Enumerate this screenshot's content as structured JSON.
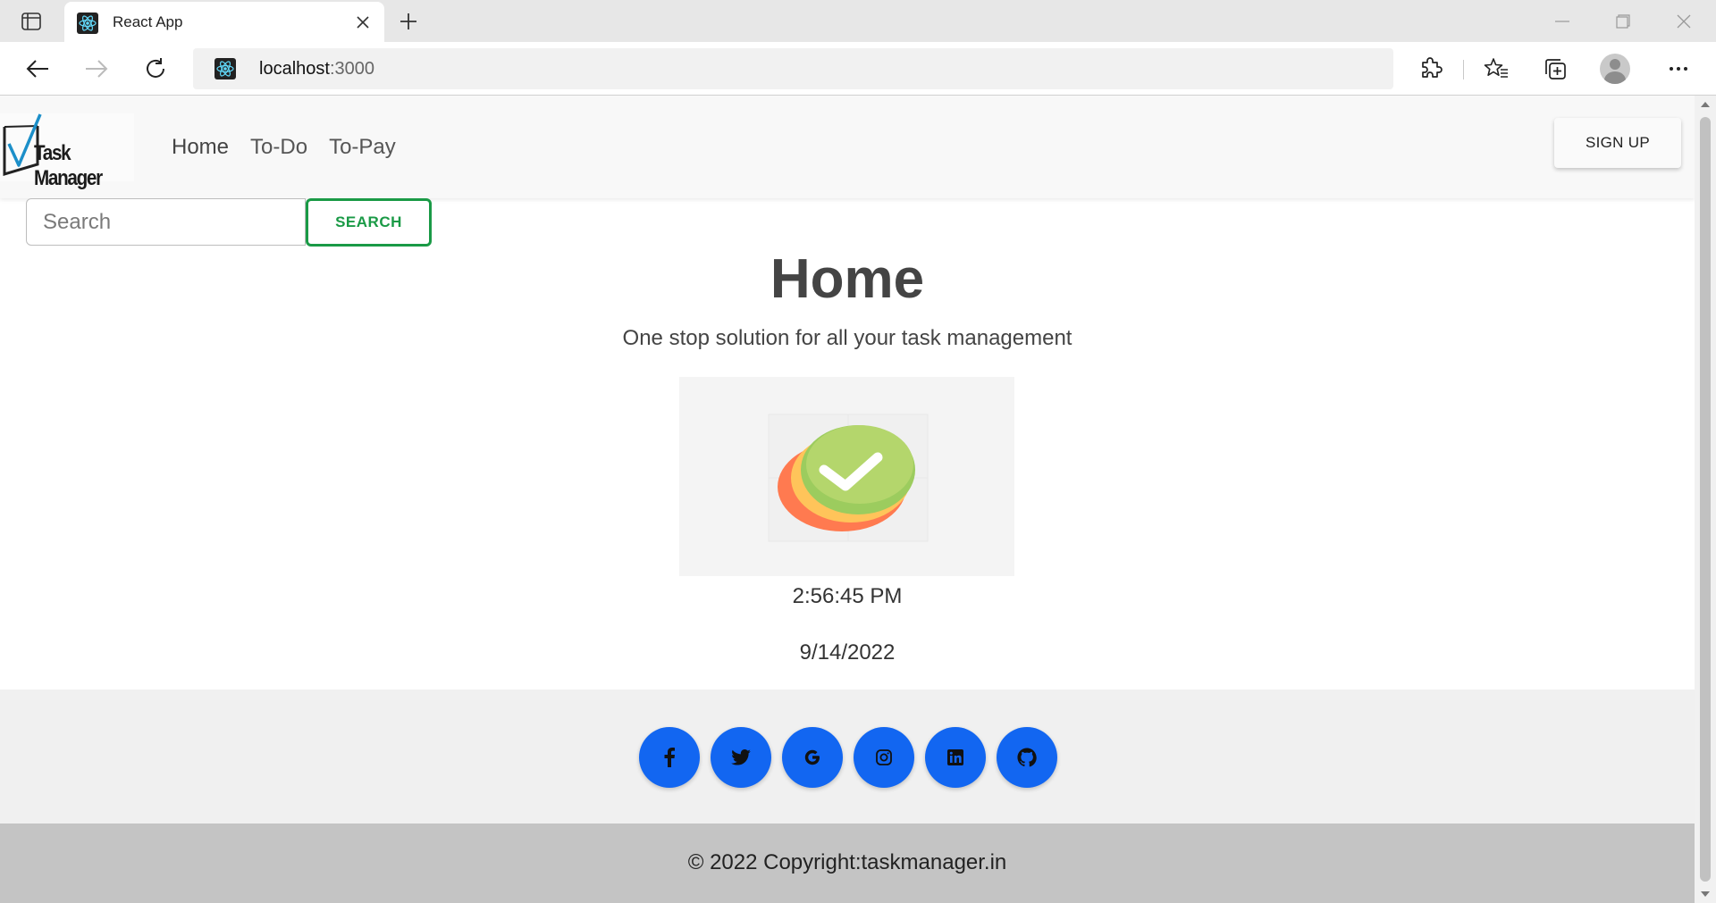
{
  "browser": {
    "tab_title": "React App",
    "url_host": "localhost",
    "url_port": ":3000"
  },
  "navbar": {
    "brand": "Task Manager",
    "links": [
      "Home",
      "To-Do",
      "To-Pay"
    ],
    "signup_label": "SIGN UP"
  },
  "search": {
    "placeholder": "Search",
    "button_label": "SEARCH"
  },
  "home": {
    "title": "Home",
    "subtitle": "One stop solution for all your task management",
    "time": "2:56:45 PM",
    "date": "9/14/2022"
  },
  "footer": {
    "social_icons": [
      "facebook-icon",
      "twitter-icon",
      "google-icon",
      "instagram-icon",
      "linkedin-icon",
      "github-icon"
    ],
    "copyright": "© 2022 Copyright:taskmanager.in"
  },
  "colors": {
    "accent_green": "#1a9a46",
    "social_blue": "#1266f1",
    "footer_gray": "#c4c4c4"
  }
}
